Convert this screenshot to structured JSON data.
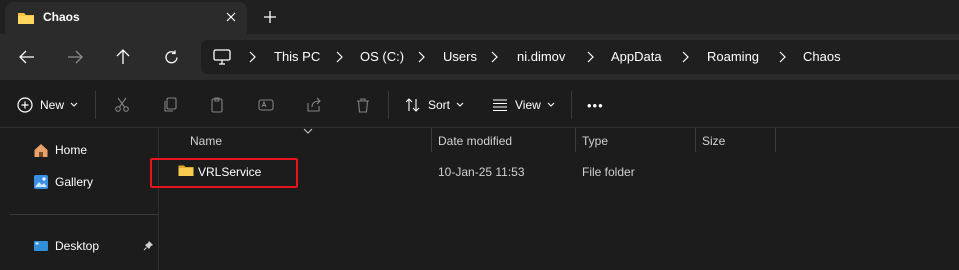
{
  "tab": {
    "title": "Chaos"
  },
  "address": {
    "crumbs": [
      "This PC",
      "OS (C:)",
      "Users",
      "ni.dimov",
      "AppData",
      "Roaming",
      "Chaos"
    ]
  },
  "toolbar": {
    "new_label": "New",
    "sort_label": "Sort",
    "view_label": "View",
    "more_label": "•••"
  },
  "sidebar": {
    "items": [
      {
        "label": "Home",
        "icon": "home-icon"
      },
      {
        "label": "Gallery",
        "icon": "gallery-icon"
      },
      {
        "label": "Desktop",
        "icon": "desktop-icon"
      }
    ]
  },
  "columns": [
    "Name",
    "Date modified",
    "Type",
    "Size"
  ],
  "files": [
    {
      "name": "VRLService",
      "date": "10-Jan-25 11:53",
      "type": "File folder",
      "size": ""
    }
  ],
  "colors": {
    "accent_folder": "#f4c542",
    "highlight": "#e8141b"
  }
}
